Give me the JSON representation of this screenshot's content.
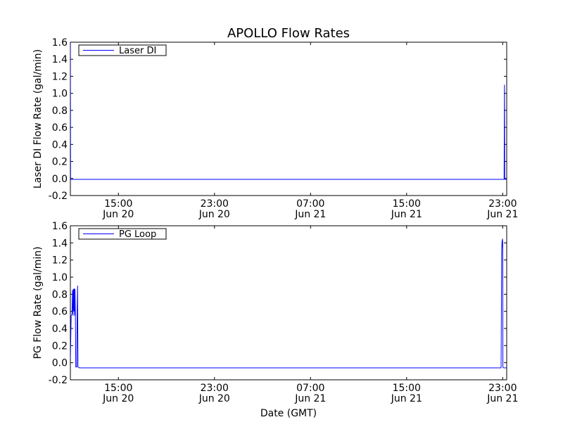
{
  "figure_title": "APOLLO Flow Rates",
  "xlabel": "Date (GMT)",
  "chart_data": [
    {
      "type": "line",
      "ylabel": "Laser DI Flow Rate (gal/min)",
      "ylim": [
        -0.2,
        1.6
      ],
      "yticks": [
        "-0.2",
        "0.0",
        "0.2",
        "0.4",
        "0.6",
        "0.8",
        "1.0",
        "1.2",
        "1.4",
        "1.6"
      ],
      "xlim": [
        "Jun 20 11:00",
        "Jun 21 23:20"
      ],
      "xticks": [
        {
          "time": "Jun 20 15:00",
          "line1": "15:00",
          "line2": "Jun 20"
        },
        {
          "time": "Jun 20 23:00",
          "line1": "23:00",
          "line2": "Jun 20"
        },
        {
          "time": "Jun 21 07:00",
          "line1": "07:00",
          "line2": "Jun 21"
        },
        {
          "time": "Jun 21 15:00",
          "line1": "15:00",
          "line2": "Jun 21"
        },
        {
          "time": "Jun 21 23:00",
          "line1": "23:00",
          "line2": "Jun 21"
        }
      ],
      "legend": {
        "label": "Laser DI",
        "placement": "top-left"
      },
      "grid": false,
      "color": "#0000ff",
      "series": [
        {
          "name": "Laser DI",
          "points": [
            [
              "Jun 20 11:00",
              1.6
            ],
            [
              "Jun 20 11:01",
              0.0
            ],
            [
              "Jun 20 11:03",
              -0.01
            ],
            [
              "Jun 20 13:00",
              -0.01
            ],
            [
              "Jun 20 17:00",
              -0.01
            ],
            [
              "Jun 20 21:00",
              -0.01
            ],
            [
              "Jun 21 01:00",
              -0.01
            ],
            [
              "Jun 21 05:00",
              -0.01
            ],
            [
              "Jun 21 09:00",
              -0.01
            ],
            [
              "Jun 21 13:00",
              -0.01
            ],
            [
              "Jun 21 17:00",
              -0.01
            ],
            [
              "Jun 21 21:00",
              -0.01
            ],
            [
              "Jun 21 23:07",
              -0.01
            ],
            [
              "Jun 21 23:08",
              0.6
            ],
            [
              "Jun 21 23:09",
              1.1
            ],
            [
              "Jun 21 23:10",
              0.0
            ],
            [
              "Jun 21 23:12",
              -0.01
            ],
            [
              "Jun 21 23:20",
              -0.01
            ]
          ]
        }
      ]
    },
    {
      "type": "line",
      "ylabel": "PG Flow Rate (gal/min)",
      "ylim": [
        -0.2,
        1.6
      ],
      "yticks": [
        "-0.2",
        "0.0",
        "0.2",
        "0.4",
        "0.6",
        "0.8",
        "1.0",
        "1.2",
        "1.4",
        "1.6"
      ],
      "xlim": [
        "Jun 20 11:00",
        "Jun 21 23:20"
      ],
      "xticks": [
        {
          "time": "Jun 20 15:00",
          "line1": "15:00",
          "line2": "Jun 20"
        },
        {
          "time": "Jun 20 23:00",
          "line1": "23:00",
          "line2": "Jun 20"
        },
        {
          "time": "Jun 21 07:00",
          "line1": "07:00",
          "line2": "Jun 21"
        },
        {
          "time": "Jun 21 15:00",
          "line1": "15:00",
          "line2": "Jun 21"
        },
        {
          "time": "Jun 21 23:00",
          "line1": "23:00",
          "line2": "Jun 21"
        }
      ],
      "legend": {
        "label": "PG Loop",
        "placement": "top-left"
      },
      "grid": false,
      "color": "#0000ff",
      "series": [
        {
          "name": "PG Loop",
          "points": [
            [
              "Jun 20 11:00",
              0.05
            ],
            [
              "Jun 20 11:04",
              0.55
            ],
            [
              "Jun 20 11:08",
              0.57
            ],
            [
              "Jun 20 11:11",
              0.85
            ],
            [
              "Jun 20 11:13",
              0.55
            ],
            [
              "Jun 20 11:15",
              0.86
            ],
            [
              "Jun 20 11:17",
              0.6
            ],
            [
              "Jun 20 11:19",
              0.87
            ],
            [
              "Jun 20 11:21",
              0.55
            ],
            [
              "Jun 20 11:23",
              0.86
            ],
            [
              "Jun 20 11:25",
              0.58
            ],
            [
              "Jun 20 11:27",
              -0.05
            ],
            [
              "Jun 20 11:32",
              -0.05
            ],
            [
              "Jun 20 11:34",
              0.6
            ],
            [
              "Jun 20 11:36",
              0.9
            ],
            [
              "Jun 20 11:38",
              -0.05
            ],
            [
              "Jun 20 11:45",
              -0.06
            ],
            [
              "Jun 20 15:00",
              -0.06
            ],
            [
              "Jun 20 19:00",
              -0.06
            ],
            [
              "Jun 20 23:00",
              -0.06
            ],
            [
              "Jun 21 03:00",
              -0.06
            ],
            [
              "Jun 21 07:00",
              -0.06
            ],
            [
              "Jun 21 11:00",
              -0.06
            ],
            [
              "Jun 21 15:00",
              -0.06
            ],
            [
              "Jun 21 19:00",
              -0.06
            ],
            [
              "Jun 21 22:45",
              -0.06
            ],
            [
              "Jun 21 22:52",
              -0.06
            ],
            [
              "Jun 21 22:55",
              1.3
            ],
            [
              "Jun 21 22:57",
              1.43
            ],
            [
              "Jun 21 22:58",
              1.35
            ],
            [
              "Jun 21 22:59",
              1.45
            ],
            [
              "Jun 21 23:00",
              1.4
            ],
            [
              "Jun 21 23:01",
              -0.05
            ],
            [
              "Jun 21 23:05",
              -0.06
            ],
            [
              "Jun 21 23:20",
              -0.06
            ]
          ]
        }
      ]
    }
  ]
}
